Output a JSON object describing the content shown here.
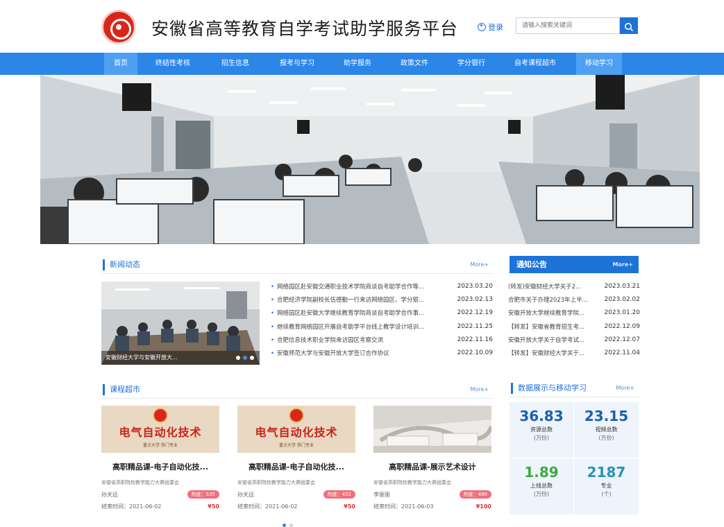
{
  "header": {
    "site_title": "安徽省高等教育自学考试助学服务平台",
    "login_label": "登录",
    "search_placeholder": "请输入搜索关键词"
  },
  "nav": {
    "items": [
      "首页",
      "终结性考核",
      "招生信息",
      "报考与学习",
      "助学服务",
      "政策文件",
      "学分银行",
      "自考课程超市",
      "移动学习"
    ],
    "active": "首页"
  },
  "news": {
    "title": "新闻动态",
    "more": "More+",
    "image_caption": "安徽财经大学与安徽开放大...",
    "items": [
      {
        "text": "网络园区赴安徽交通职业技术学院商谈自考助学合作等...",
        "date": "2023.03.20"
      },
      {
        "text": "合肥经济学院副校长伍德勤一行来访网络园区、学分银...",
        "date": "2023.02.13"
      },
      {
        "text": "网络园区赴安徽大学继续教育学院商谈自考助学合作事...",
        "date": "2022.12.19"
      },
      {
        "text": "继续教育网络园区开展自考助学平台线上教学设计培训...",
        "date": "2022.11.25"
      },
      {
        "text": "合肥信息技术职业学院来访园区考察交流",
        "date": "2022.11.16"
      },
      {
        "text": "安徽师范大学与安徽开放大学签订合作协议",
        "date": "2022.10.09"
      }
    ]
  },
  "notice": {
    "title": "通知公告",
    "more": "More+",
    "items": [
      {
        "text": "(转发)安徽财经大学关于2...",
        "date": "2023.03.21"
      },
      {
        "text": "合肥市关于办理2023年上半...",
        "date": "2023.02.02"
      },
      {
        "text": "安徽开放大学继续教育学院...",
        "date": "2023.01.20"
      },
      {
        "text": "【转发】安徽省教育招生考...",
        "date": "2022.12.09"
      },
      {
        "text": "安徽开放大学关于自学考试...",
        "date": "2022.12.07"
      },
      {
        "text": "【转发】安徽财经大学关于...",
        "date": "2022.11.04"
      }
    ]
  },
  "courses": {
    "title": "课程超市",
    "more": "More+",
    "items": [
      {
        "image_text": "电气自动化技术",
        "image_sub": "重点大学 热门专业",
        "title": "高职精品课-电子自动化技...",
        "org": "安徽省高职院校教学能力大赛组委会",
        "teacher": "孙天远",
        "hot": "热度：535",
        "end_date": "结束时间：2021-06-02",
        "price": "¥50"
      },
      {
        "image_text": "电气自动化技术",
        "image_sub": "重点大学 热门专业",
        "title": "高职精品课-电子自动化技...",
        "org": "安徽省高职院校教学能力大赛组委会",
        "teacher": "孙天远",
        "hot": "热度：452",
        "end_date": "结束时间：2021-06-02",
        "price": "¥50"
      },
      {
        "image_text": "",
        "image_sub": "",
        "title": "高职精品课-展示艺术设计",
        "org": "安徽省高职院校教学能力大赛组委会",
        "teacher": "李丽丽",
        "hot": "热度：468",
        "end_date": "结束时间：2021-06-03",
        "price": "¥100"
      }
    ]
  },
  "stats": {
    "title": "数据展示与移动学习",
    "more": "More+",
    "items": [
      {
        "value": "36.83",
        "label": "资源总数",
        "unit": "(万份)",
        "color": "#1c5fae"
      },
      {
        "value": "23.15",
        "label": "视频总数",
        "unit": "(万份)",
        "color": "#1c5fae"
      },
      {
        "value": "1.89",
        "label": "上线总数",
        "unit": "(万份)",
        "color": "#3cab3c"
      },
      {
        "value": "2187",
        "label": "专业",
        "unit": "(个)",
        "color": "#2a90b8"
      }
    ]
  },
  "colors": {
    "nav": "#2b86e8",
    "accent": "#1e73d8",
    "hot_badge": "#f1707e"
  }
}
